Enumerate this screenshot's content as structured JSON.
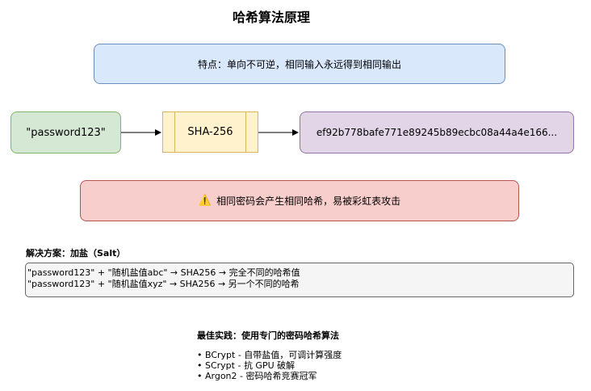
{
  "title": "哈希算法原理",
  "feature_text": "特点：单向不可逆，相同输入永远得到相同输出",
  "input_text": "\"password123\"",
  "process_text": "SHA-256",
  "output_text": "ef92b778bafe771e89245b89ecbc08a44a4e166...",
  "warning": {
    "icon": "⚠️",
    "text": "相同密码会产生相同哈希，易被彩虹表攻击"
  },
  "solution": {
    "title": "解决方案：加盐（Salt）",
    "lines": [
      "\"password123\" + \"随机盐值abc\" → SHA256 → 完全不同的哈希值",
      "\"password123\" + \"随机盐值xyz\" → SHA256 → 另一个不同的哈希"
    ]
  },
  "best_practice": {
    "title": "最佳实践：使用专门的密码哈希算法",
    "items": [
      "• BCrypt - 自带盐值，可调计算强度",
      "• SCrypt - 抗 GPU 破解",
      "• Argon2 - 密码哈希竞赛冠军"
    ]
  },
  "colors": {
    "feature_fill": "#dae8fc",
    "input_fill": "#d5e8d4",
    "process_fill": "#fff2cc",
    "output_fill": "#e1d5e7",
    "warning_fill": "#f8cecc",
    "code_fill": "#f5f5f5"
  }
}
